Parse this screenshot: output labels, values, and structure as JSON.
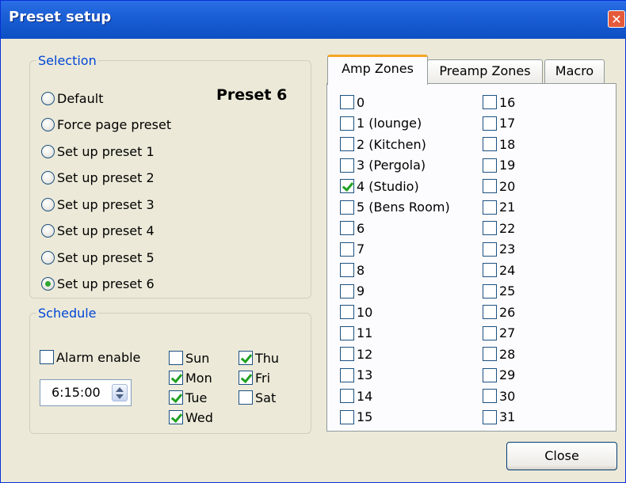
{
  "window": {
    "title": "Preset setup"
  },
  "selection": {
    "legend": "Selection",
    "preset_title": "Preset 6",
    "options": [
      {
        "label": "Default",
        "selected": false
      },
      {
        "label": "Force page preset",
        "selected": false
      },
      {
        "label": "Set up preset 1",
        "selected": false
      },
      {
        "label": "Set up preset 2",
        "selected": false
      },
      {
        "label": "Set up preset 3",
        "selected": false
      },
      {
        "label": "Set up preset 4",
        "selected": false
      },
      {
        "label": "Set up preset 5",
        "selected": false
      },
      {
        "label": "Set up preset 6",
        "selected": true
      }
    ]
  },
  "schedule": {
    "legend": "Schedule",
    "alarm_label": "Alarm enable",
    "alarm_checked": false,
    "time": "6:15:00",
    "days": [
      {
        "label": "Sun",
        "checked": false
      },
      {
        "label": "Mon",
        "checked": true
      },
      {
        "label": "Tue",
        "checked": true
      },
      {
        "label": "Wed",
        "checked": true
      },
      {
        "label": "Thu",
        "checked": true
      },
      {
        "label": "Fri",
        "checked": true
      },
      {
        "label": "Sat",
        "checked": false
      }
    ]
  },
  "tabs": [
    {
      "label": "Amp Zones",
      "active": true
    },
    {
      "label": "Preamp Zones",
      "active": false
    },
    {
      "label": "Macro",
      "active": false
    }
  ],
  "zones": [
    {
      "label": "0",
      "checked": false
    },
    {
      "label": "1 (lounge)",
      "checked": false
    },
    {
      "label": "2 (Kitchen)",
      "checked": false
    },
    {
      "label": "3 (Pergola)",
      "checked": false
    },
    {
      "label": "4 (Studio)",
      "checked": true
    },
    {
      "label": "5 (Bens Room)",
      "checked": false
    },
    {
      "label": "6",
      "checked": false
    },
    {
      "label": "7",
      "checked": false
    },
    {
      "label": "8",
      "checked": false
    },
    {
      "label": "9",
      "checked": false
    },
    {
      "label": "10",
      "checked": false
    },
    {
      "label": "11",
      "checked": false
    },
    {
      "label": "12",
      "checked": false
    },
    {
      "label": "13",
      "checked": false
    },
    {
      "label": "14",
      "checked": false
    },
    {
      "label": "15",
      "checked": false
    },
    {
      "label": "16",
      "checked": false
    },
    {
      "label": "17",
      "checked": false
    },
    {
      "label": "18",
      "checked": false
    },
    {
      "label": "19",
      "checked": false
    },
    {
      "label": "20",
      "checked": false
    },
    {
      "label": "21",
      "checked": false
    },
    {
      "label": "22",
      "checked": false
    },
    {
      "label": "23",
      "checked": false
    },
    {
      "label": "24",
      "checked": false
    },
    {
      "label": "25",
      "checked": false
    },
    {
      "label": "26",
      "checked": false
    },
    {
      "label": "27",
      "checked": false
    },
    {
      "label": "28",
      "checked": false
    },
    {
      "label": "29",
      "checked": false
    },
    {
      "label": "30",
      "checked": false
    },
    {
      "label": "31",
      "checked": false
    }
  ],
  "buttons": {
    "close": "Close"
  },
  "icons": {
    "close": "close-icon",
    "spinner": "spinner-arrows-icon"
  }
}
